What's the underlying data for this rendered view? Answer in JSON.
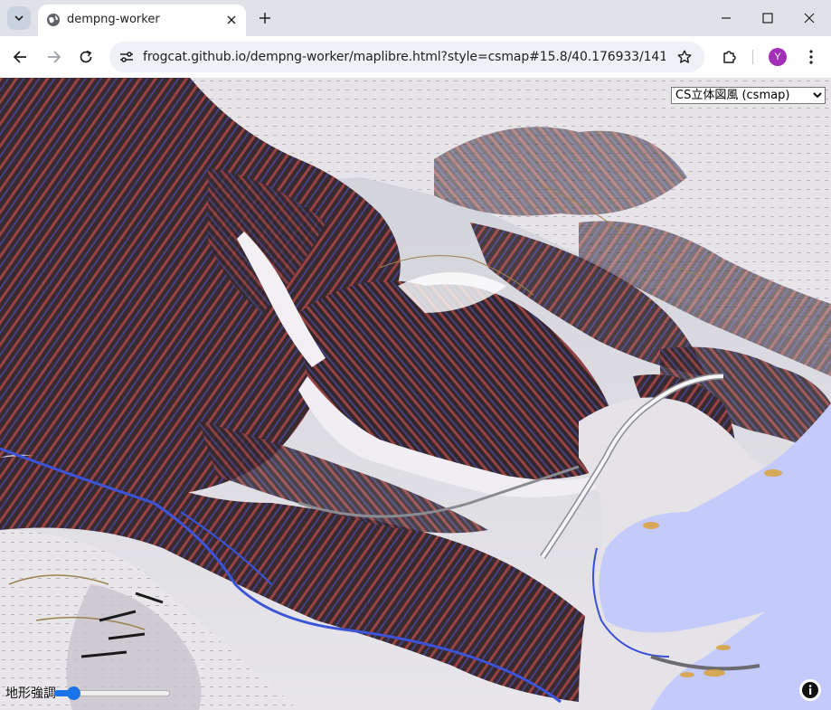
{
  "tab": {
    "title": "dempng-worker"
  },
  "toolbar": {
    "url": "frogcat.github.io/dempng-worker/maplibre.html?style=csmap#15.8/40.176933/141.818219..."
  },
  "profile": {
    "initial": "Y",
    "color": "#a22fb5"
  },
  "map": {
    "style_select": {
      "selected": "CS立体図風 (csmap)"
    },
    "terrain_slider": {
      "label": "地形強調",
      "value": 0.12
    }
  },
  "icons": {
    "tab_search": "chevron-down-icon",
    "favicon": "globe-icon",
    "tab_close": "close-icon",
    "new_tab": "plus-icon",
    "minimize": "minimize-icon",
    "maximize": "maximize-icon",
    "close": "close-icon",
    "back": "arrow-left-icon",
    "forward": "arrow-right-icon",
    "reload": "reload-icon",
    "site_info": "tune-icon",
    "bookmark": "star-icon",
    "extensions": "puzzle-icon",
    "menu": "more-vert-icon",
    "attribution": "info-icon"
  }
}
